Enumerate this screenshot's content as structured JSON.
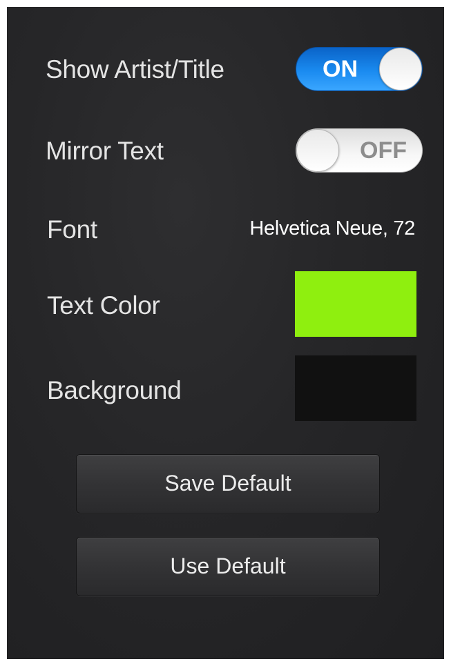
{
  "settings": {
    "show_artist_title": {
      "label": "Show Artist/Title",
      "state": "ON",
      "on": true
    },
    "mirror_text": {
      "label": "Mirror Text",
      "state": "OFF",
      "on": false
    },
    "font": {
      "label": "Font",
      "value": "Helvetica Neue, 72"
    },
    "text_color": {
      "label": "Text Color",
      "color": "#8fef0f"
    },
    "background": {
      "label": "Background",
      "color": "#111111"
    }
  },
  "buttons": {
    "save_default": "Save Default",
    "use_default": "Use Default"
  },
  "colors": {
    "panel_background": "#262628",
    "toggle_on": "#1a8bf0",
    "toggle_off": "#f2f2f2"
  }
}
